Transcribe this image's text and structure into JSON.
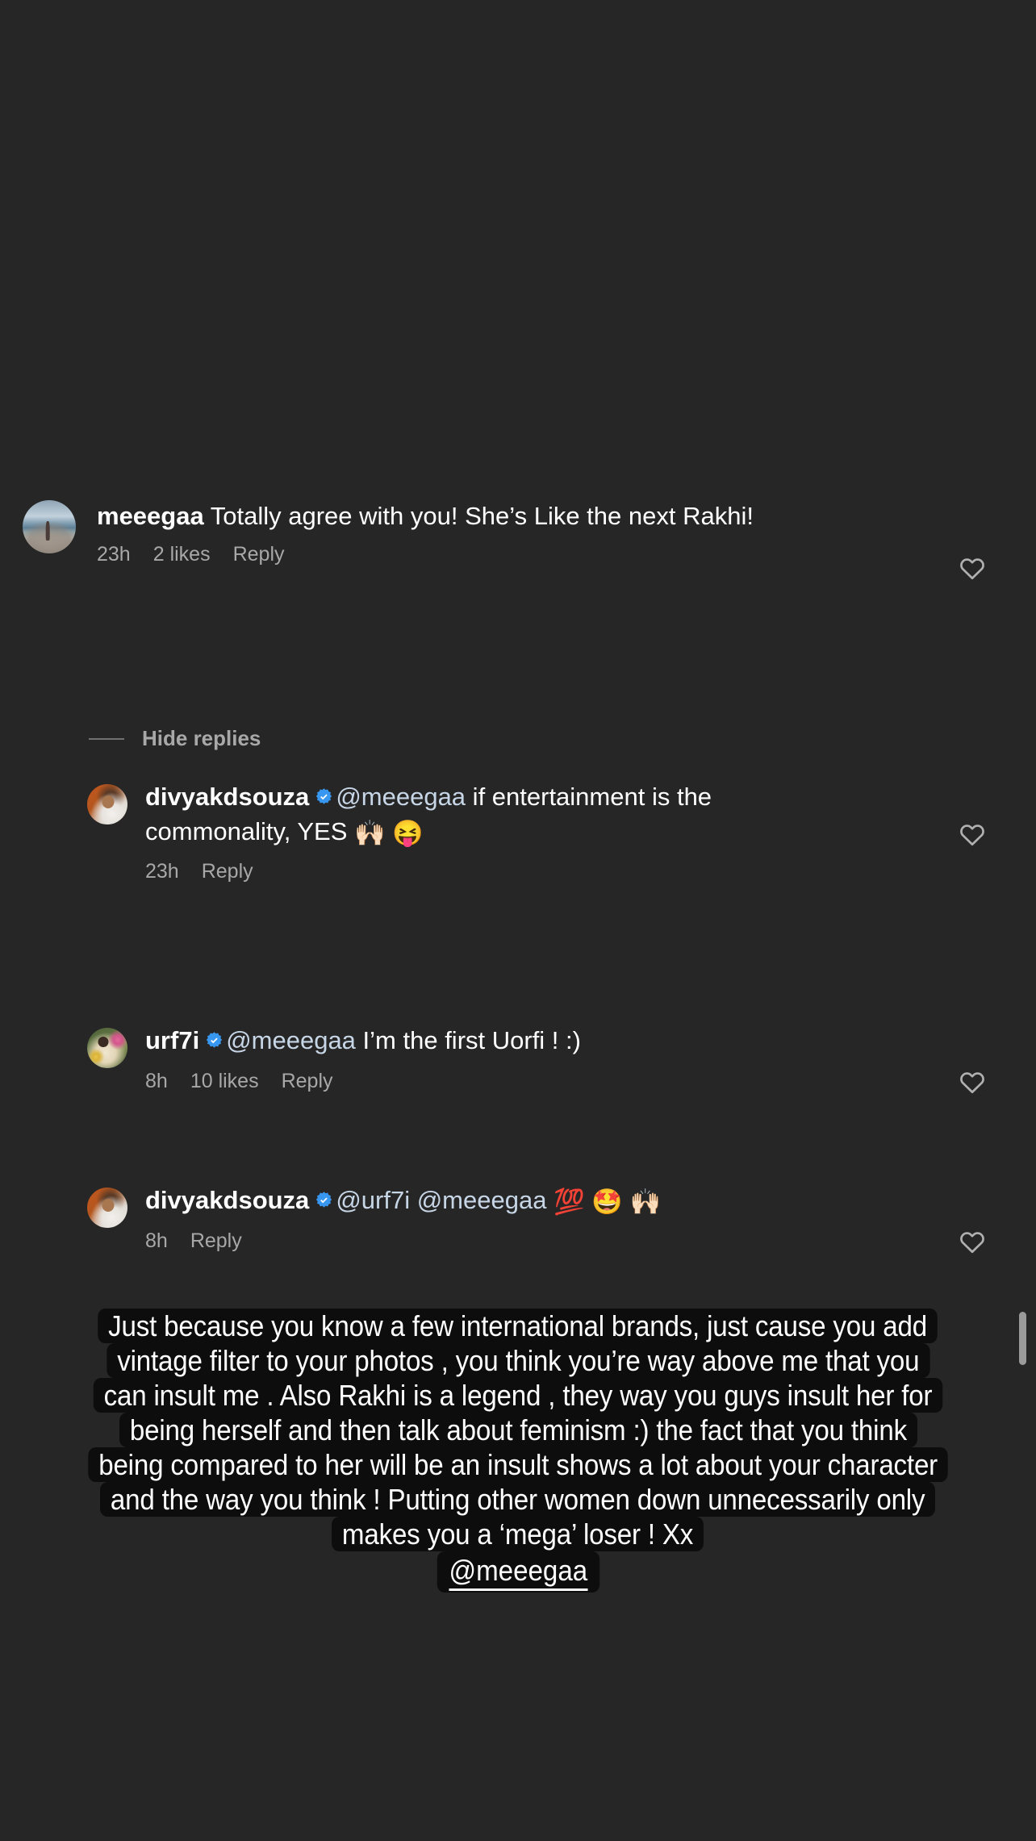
{
  "app": {
    "background_color": "#262626",
    "text_color": "#ffffff",
    "muted_text_color": "#a8a8a8",
    "mention_color": "#c7d6e6",
    "verified_badge_color": "#3897f0"
  },
  "comments": [
    {
      "username": "meeegaa",
      "verified": false,
      "avatar": "beach-photo-avatar",
      "text": " Totally agree with you! She’s Like the next Rakhi!",
      "mention": "",
      "emoji": "",
      "meta": [
        "23h",
        "2 likes",
        "Reply"
      ],
      "like_icon": "heart-outline-icon"
    },
    {
      "username": "divyakdsouza",
      "verified": true,
      "avatar": "man-white-shirt-avatar",
      "text": " if entertainment is the commonality, YES ",
      "mention": "@meeegaa",
      "emoji": "🙌🏻 😝",
      "meta": [
        "23h",
        "Reply"
      ],
      "like_icon": "heart-outline-icon"
    },
    {
      "username": "urf7i",
      "verified": true,
      "avatar": "woman-flowers-avatar",
      "text": " I’m the first Uorfi ! :)",
      "mention": "@meeegaa",
      "emoji": "",
      "meta": [
        "8h",
        "10 likes",
        "Reply"
      ],
      "like_icon": "heart-outline-icon"
    },
    {
      "username": "divyakdsouza",
      "verified": true,
      "avatar": "man-white-shirt-avatar",
      "text": " ",
      "mention": "@urf7i @meeegaa",
      "emoji": "💯 🤩 🙌🏻",
      "meta": [
        "8h",
        "Reply"
      ],
      "like_icon": "heart-outline-icon"
    }
  ],
  "hide_replies": {
    "label": "Hide replies"
  },
  "overlay": {
    "lines": [
      "Just because you know a few international brands, just cause you add",
      "vintage filter to your photos , you think you’re way above me that you",
      "can insult me . Also Rakhi is a legend , they way you guys insult her for",
      "being herself and then talk about feminism :)  the fact that you think",
      "being compared to her will be an insult shows a lot about your character",
      "and the way you think ! Putting other women down unnecessarily only",
      "makes you a ‘mega’ loser ! Xx"
    ],
    "mention": "@meeegaa",
    "background_color": "#0d0d0d"
  },
  "scrollbar": {
    "visible": true
  }
}
